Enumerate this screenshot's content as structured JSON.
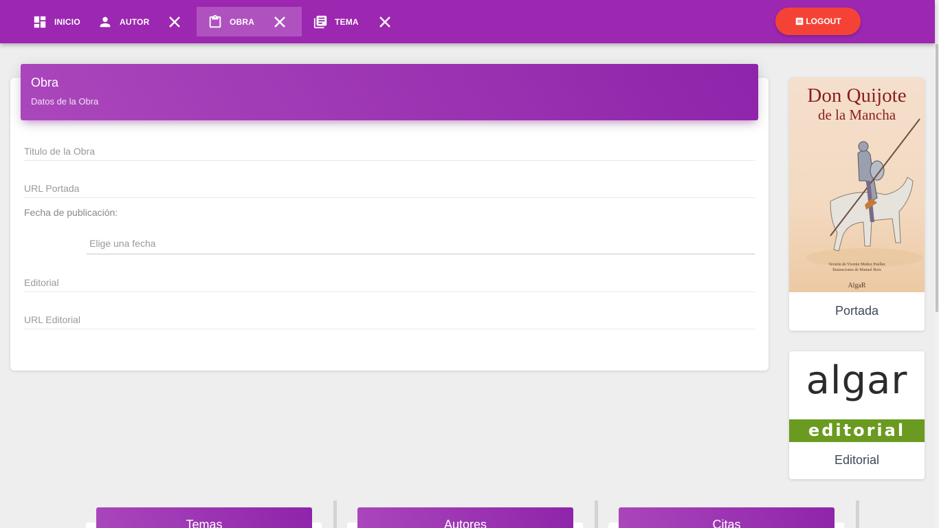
{
  "navbar": {
    "tabs": [
      {
        "label": "INICIO",
        "icon": "dashboard-icon"
      },
      {
        "label": "AUTOR",
        "icon": "person-icon"
      },
      {
        "label": "OBRA",
        "icon": "clipboard-icon",
        "active": true
      },
      {
        "label": "TEMA",
        "icon": "library-books-icon"
      }
    ],
    "logout_label": "LOGOUT",
    "color": "#9c27b0",
    "logout_color": "#f44336"
  },
  "form": {
    "title": "Obra",
    "subtitle": "Datos de la Obra",
    "titulo_placeholder": "Titulo de la Obra",
    "url_portada_placeholder": "URL Portada",
    "fecha_label": "Fecha de publicación:",
    "fecha_placeholder": "Elige una fecha",
    "editorial_placeholder": "Editorial",
    "url_editorial_placeholder": "URL Editorial"
  },
  "cover_card": {
    "book_title": "Don Quijote",
    "book_subtitle": "de la Mancha",
    "credit_line1": "Versión de Vicente Muñoz Puelles",
    "credit_line2": "Ilustraciones de Manuel Boix",
    "publisher": "AlgaR",
    "caption": "Portada"
  },
  "editorial_card": {
    "logo_word": "algar",
    "logo_band": "editorial",
    "band_color": "#6a9a1f",
    "caption": "Editorial"
  },
  "bottom_cards": [
    {
      "title": "Temas"
    },
    {
      "title": "Autores"
    },
    {
      "title": "Citas"
    }
  ]
}
